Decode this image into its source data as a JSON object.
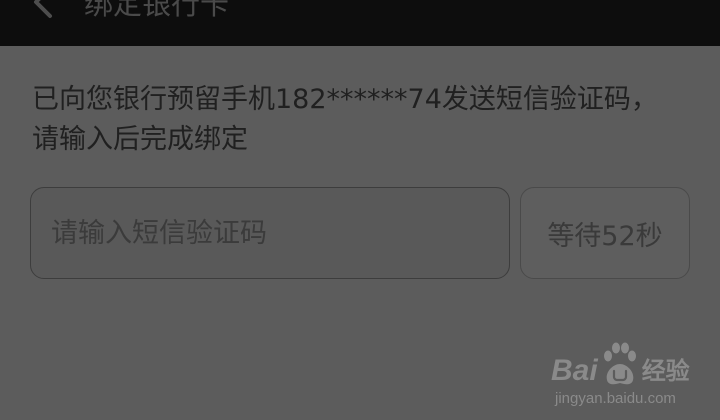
{
  "header": {
    "title": "绑定银行卡",
    "back_icon": "chevron-left-icon"
  },
  "message": {
    "text": "已向您银行预留手机182******74发送短信验证码，请输入后完成绑定"
  },
  "verification": {
    "input_value": "",
    "input_placeholder": "请输入短信验证码",
    "wait_button_label": "等待52秒"
  },
  "watermark": {
    "brand_text": "经验",
    "url": "jingyan.baidu.com"
  },
  "colors": {
    "topbar": "#0d0d0d",
    "overlay_background": "#5c5c5c",
    "text": "#202020",
    "watermark": "#8a8a8a"
  }
}
